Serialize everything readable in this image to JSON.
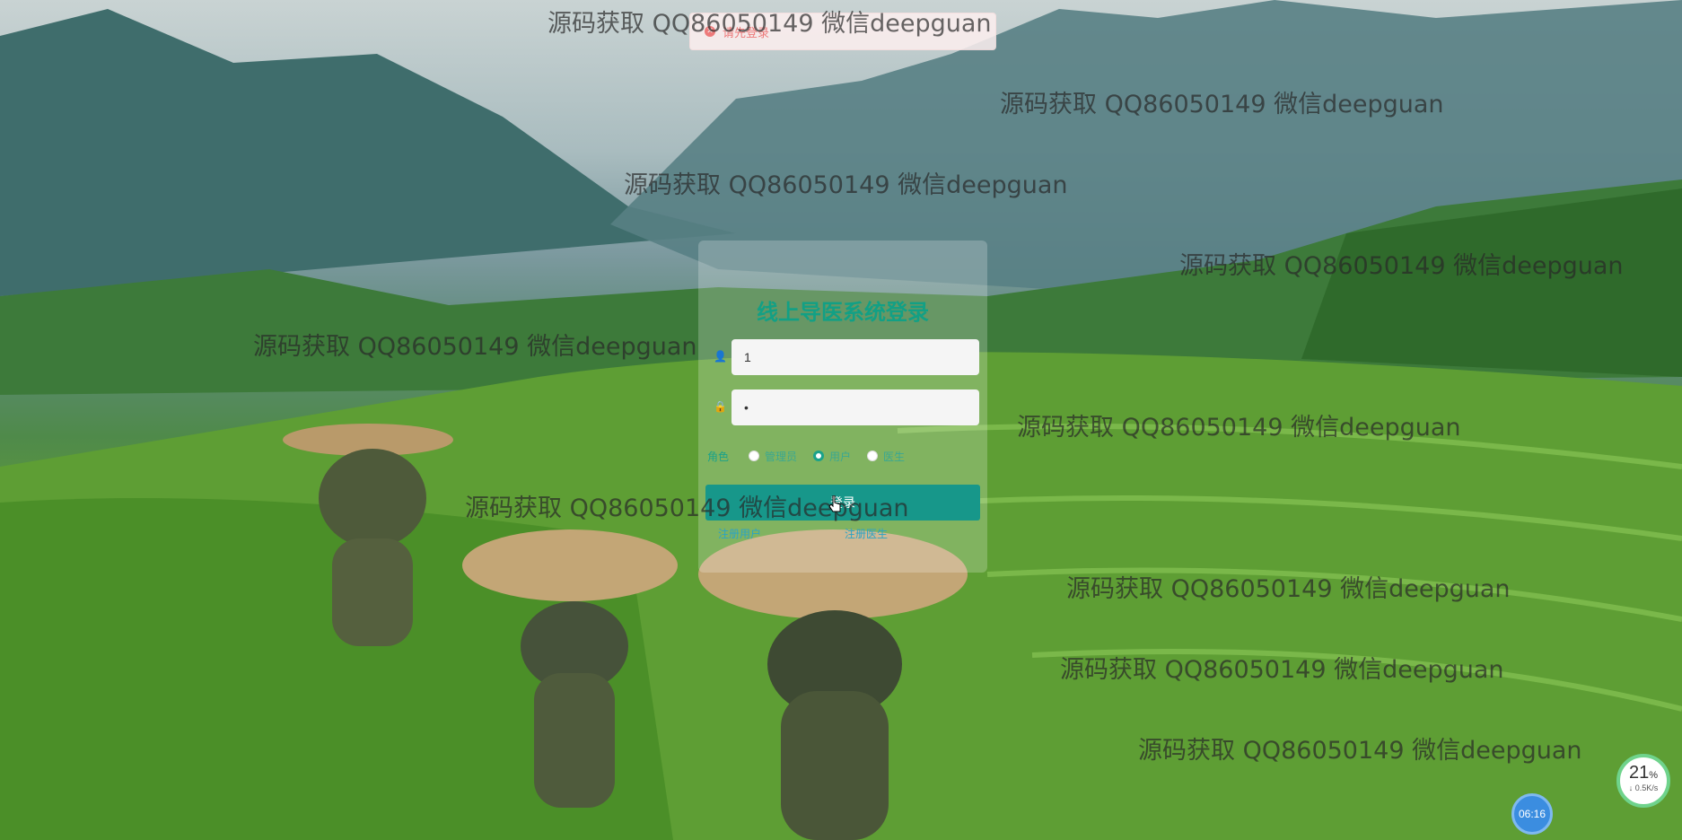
{
  "toast": {
    "icon": "error-circle-icon",
    "message": "请先登录"
  },
  "login": {
    "title": "线上导医系统登录",
    "username_value": "1",
    "password_value": "•",
    "role_label": "角色",
    "roles": [
      {
        "label": "管理员",
        "selected": false
      },
      {
        "label": "用户",
        "selected": true
      },
      {
        "label": "医生",
        "selected": false
      }
    ],
    "login_button": "登录",
    "register_user": "注册用户",
    "register_doctor": "注册医生"
  },
  "watermarks": [
    "源码获取 QQ86050149 微信deepguan",
    "源码获取 QQ86050149 微信deepguan",
    "源码获取 QQ86050149 微信deepguan",
    "源码获取 QQ86050149 微信deepguan",
    "源码获取 QQ86050149 微信deepguan",
    "源码获取 QQ86050149 微信deepguan",
    "源码获取 QQ86050149 微信deepguan",
    "源码获取 QQ86050149 微信deepguan",
    "源码获取 QQ86050149 微信deepguan",
    "源码获取 QQ86050149 微信deepguan"
  ],
  "system": {
    "cpu_percent": "21",
    "percent_sign": "%",
    "net_rate": "↓ 0.5K/s",
    "clock": "06:16"
  },
  "colors": {
    "accent": "#17978a",
    "title": "#12a085",
    "error": "#f56c6c"
  }
}
